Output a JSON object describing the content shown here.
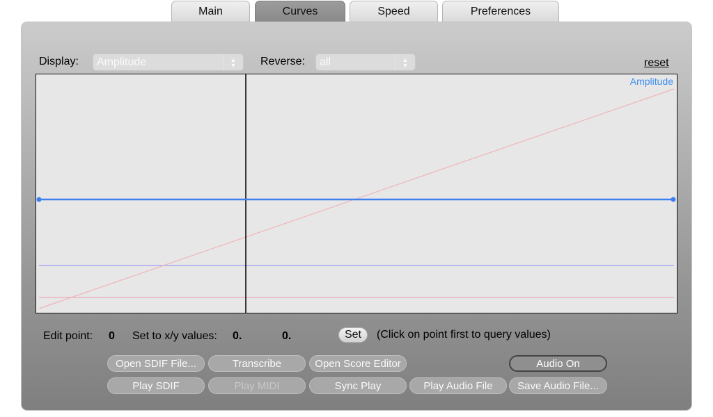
{
  "tabs": [
    {
      "label": "Main"
    },
    {
      "label": "Curves"
    },
    {
      "label": "Speed"
    },
    {
      "label": "Preferences"
    }
  ],
  "active_tab": "Curves",
  "controls": {
    "display_label": "Display:",
    "display_value": "Amplitude",
    "reverse_label": "Reverse:",
    "reverse_value": "all",
    "reset_label": "reset"
  },
  "curve": {
    "active_curve_label": "Amplitude",
    "colors": {
      "amplitude": "#3f80f0",
      "diagonal": "#f0b4b8",
      "faint_blue": "#b9b9ef",
      "faint_pink": "#ebbfca",
      "playhead": "#000000"
    }
  },
  "edit": {
    "edit_point_label": "Edit point:",
    "edit_point_value": "0",
    "set_xy_label": "Set to x/y values:",
    "x_value": "0.",
    "y_value": "0.",
    "set_button": "Set",
    "hint": "(Click on point first to query values)"
  },
  "buttons": {
    "open_sdif": "Open SDIF File...",
    "transcribe": "Transcribe",
    "open_score_editor": "Open Score Editor",
    "audio_on": "Audio On",
    "play_sdif": "Play SDIF",
    "play_midi": "Play MIDI",
    "sync_play": "Sync Play",
    "play_audio_file": "Play Audio File",
    "save_audio_file": "Save Audio File..."
  }
}
